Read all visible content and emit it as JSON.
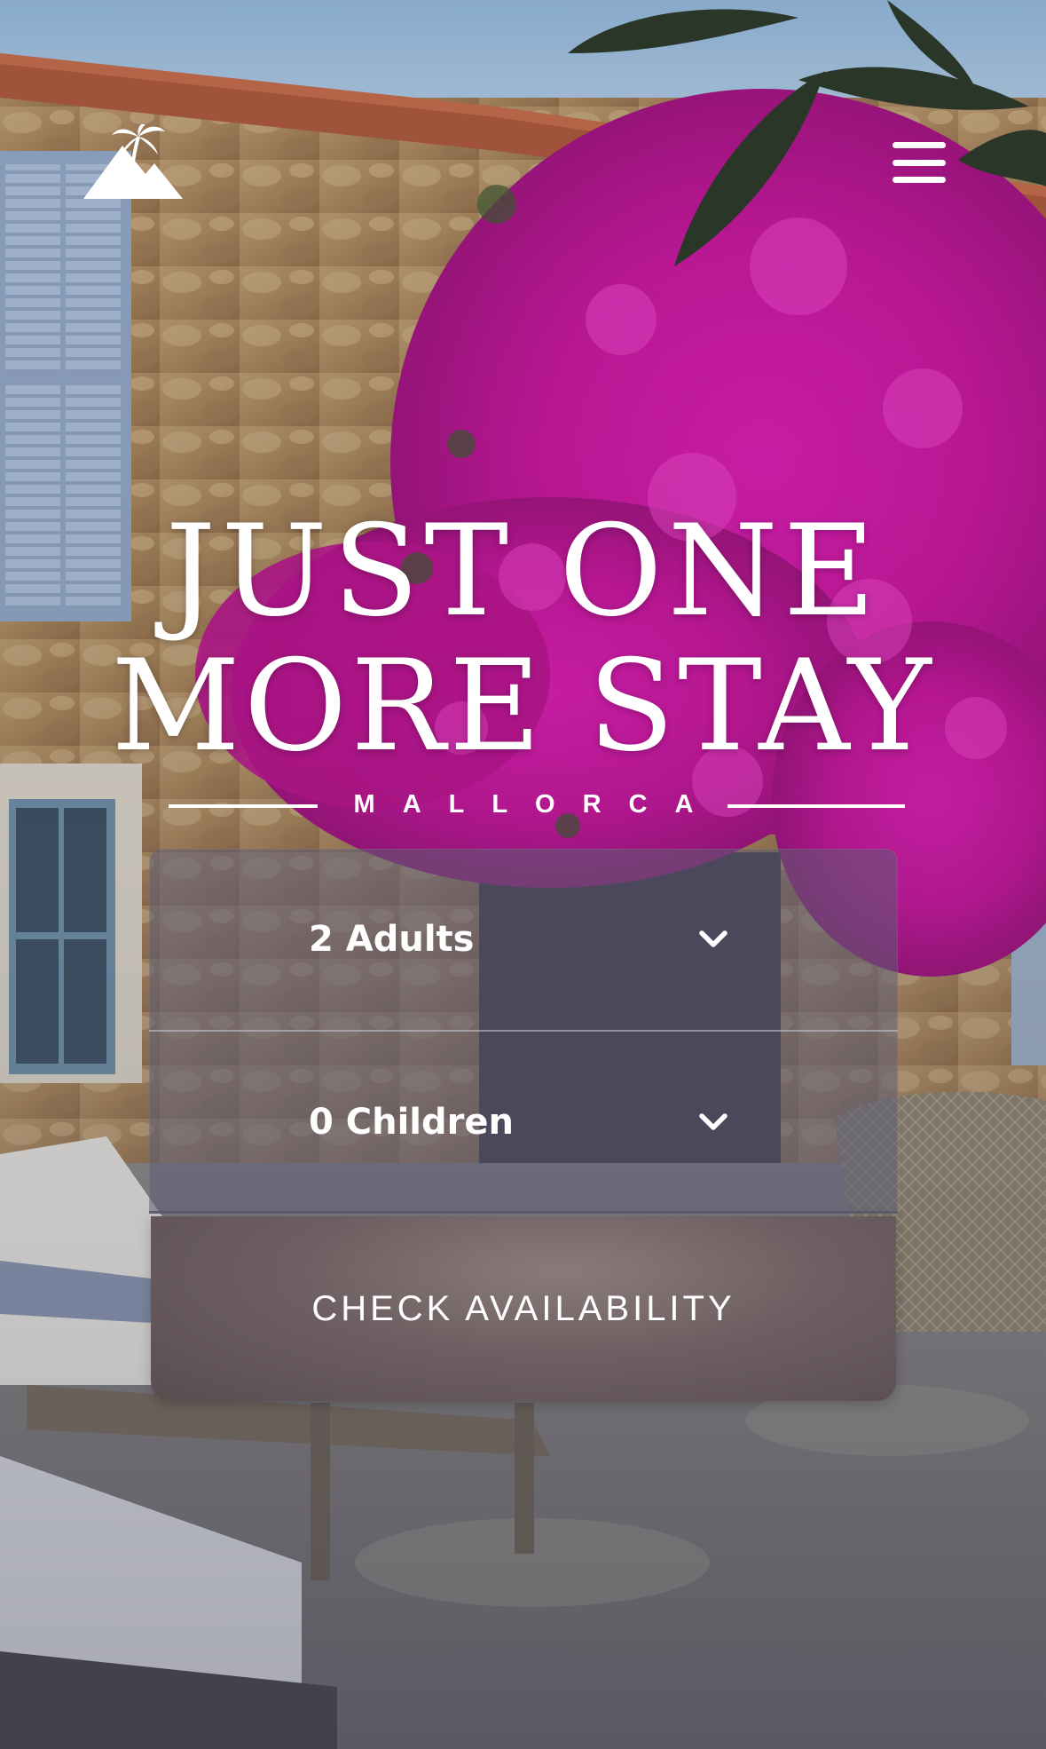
{
  "header": {
    "logo_icon": "palm-island-logo-icon",
    "menu_icon": "hamburger-menu-icon"
  },
  "hero": {
    "title_line1": "JUST ONE",
    "title_line2": "MORE STAY",
    "subtitle": "MALLORCA"
  },
  "booking": {
    "adults": {
      "selected": "2 Adults",
      "icon": "chevron-down-icon"
    },
    "children": {
      "selected": "0 Children",
      "icon": "chevron-down-icon"
    },
    "check_label": "CHECK AVAILABILITY"
  },
  "colors": {
    "text": "#ffffff",
    "panel": "#5c5c74",
    "button": "#6e6062",
    "bougainvillea": "#c8189e"
  }
}
